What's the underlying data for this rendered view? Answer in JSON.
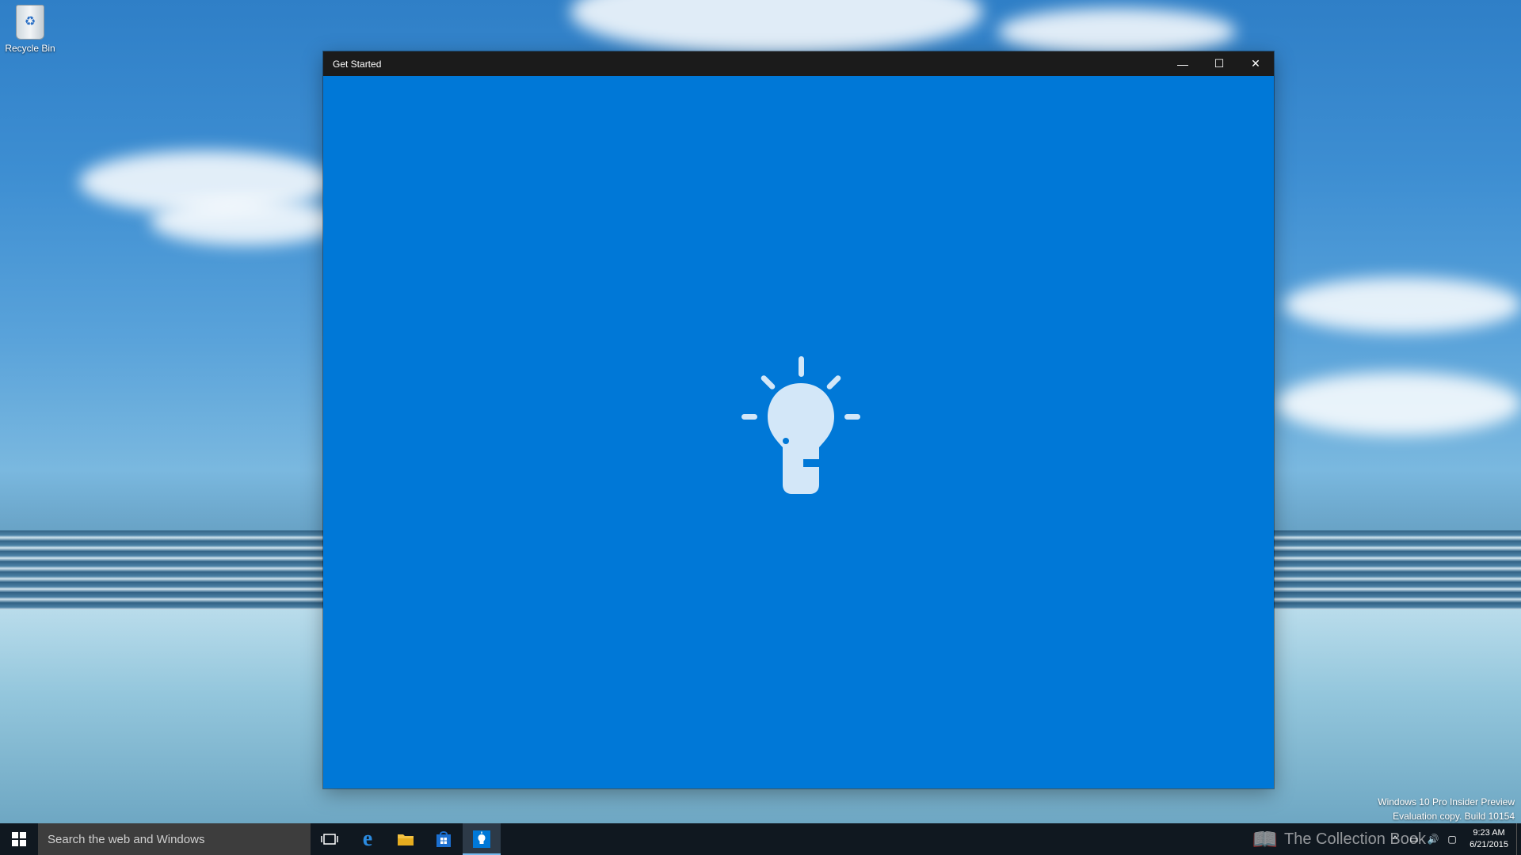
{
  "desktop": {
    "recycle_bin_label": "Recycle Bin",
    "watermark_line1": "Windows 10 Pro Insider Preview",
    "watermark_line2": "Evaluation copy. Build 10154"
  },
  "window": {
    "title": "Get Started",
    "minimize_glyph": "—",
    "maximize_glyph": "☐",
    "close_glyph": "✕",
    "background_color": "#0078d7",
    "splash_icon": "lightbulb-icon"
  },
  "taskbar": {
    "search_placeholder": "Search the web and Windows",
    "pinned": [
      {
        "name": "task-view",
        "icon": "task-view-icon"
      },
      {
        "name": "edge",
        "icon": "edge-icon"
      },
      {
        "name": "file-explorer",
        "icon": "folder-icon"
      },
      {
        "name": "store",
        "icon": "store-icon"
      },
      {
        "name": "get-started",
        "icon": "lightbulb-icon",
        "active": true
      }
    ],
    "brand_text": "The Collection Book",
    "time": "9:23 AM",
    "date": "6/21/2015"
  },
  "colors": {
    "accent": "#0078d7",
    "titlebar": "#1b1b1b",
    "taskbar": "#101820"
  }
}
